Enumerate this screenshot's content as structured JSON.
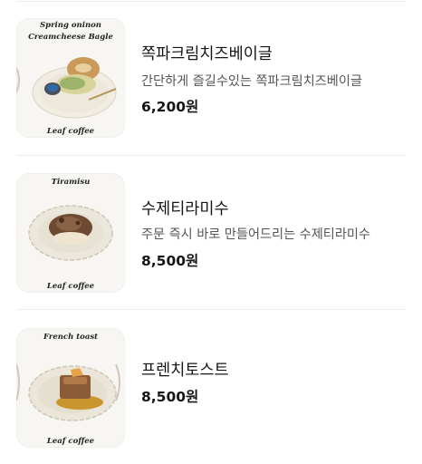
{
  "menu": {
    "items": [
      {
        "name": "쪽파크림치즈베이글",
        "description": "간단하게 즐길수있는 쪽파크림치즈베이글",
        "price": "6,200원",
        "image_caption_line1": "Spring oninon",
        "image_caption_line2": "Creamcheese Bagle",
        "image_brand": "Leaf coffee"
      },
      {
        "name": "수제티라미수",
        "description": "주문 즉시 바로 만들어드리는 수제티라미수",
        "price": "8,500원",
        "image_caption_line1": "Tiramisu",
        "image_brand": "Leaf coffee"
      },
      {
        "name": "프렌치토스트",
        "price": "8,500원",
        "image_caption_line1": "French toast",
        "image_brand": "Leaf coffee"
      }
    ]
  }
}
